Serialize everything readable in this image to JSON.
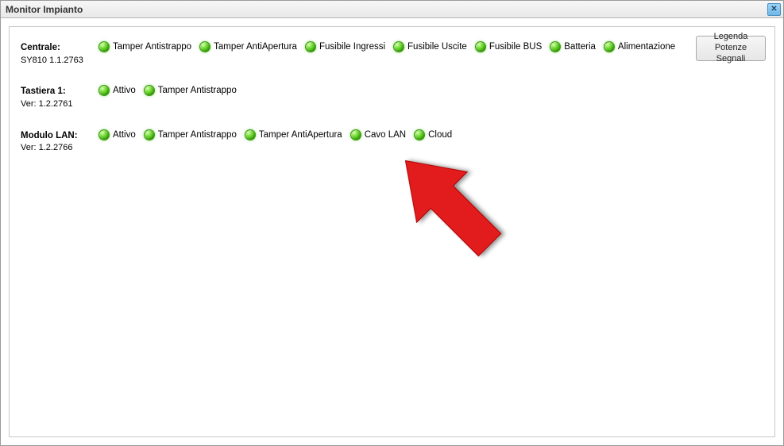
{
  "window": {
    "title": "Monitor Impianto"
  },
  "legend_button": "Legenda\nPotenze Segnali",
  "devices": [
    {
      "name": "Centrale:",
      "sub": "SY810 1.1.2763",
      "statuses": [
        "Tamper Antistrappo",
        "Tamper AntiApertura",
        "Fusibile Ingressi",
        "Fusibile Uscite",
        "Fusibile BUS",
        "Batteria",
        "Alimentazione"
      ]
    },
    {
      "name": "Tastiera 1:",
      "sub": "Ver: 1.2.2761",
      "statuses": [
        "Attivo",
        "Tamper Antistrappo"
      ]
    },
    {
      "name": "Modulo LAN:",
      "sub": "Ver: 1.2.2766",
      "statuses": [
        "Attivo",
        "Tamper Antistrappo",
        "Tamper AntiApertura",
        "Cavo LAN",
        "Cloud"
      ]
    }
  ]
}
